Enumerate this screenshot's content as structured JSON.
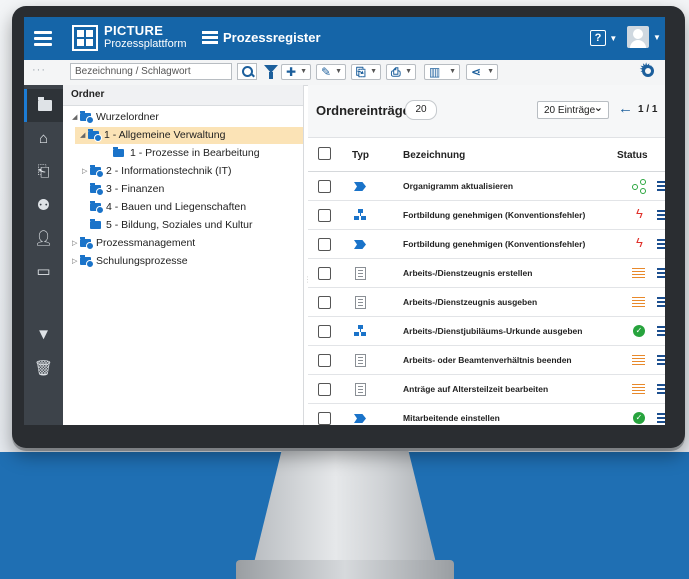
{
  "app": {
    "brand_line1": "PICTURE",
    "brand_line2": "Prozessplattform",
    "module_title": "Prozessregister",
    "help_label": "?"
  },
  "toolbar": {
    "search_placeholder": "Bezeichnung / Schlagwort"
  },
  "folder_panel": {
    "header": "Ordner",
    "tree": [
      {
        "label": "Wurzelordner",
        "level": 0,
        "expanded": true,
        "selected": false
      },
      {
        "label": "1 - Allgemeine Verwaltung",
        "level": 1,
        "expanded": true,
        "selected": true
      },
      {
        "label": "1 - Prozesse in Bearbeitung",
        "level": 2,
        "expanded": false,
        "selected": false
      },
      {
        "label": "2 - Informationstechnik (IT)",
        "level": 1,
        "expanded": false,
        "selected": false
      },
      {
        "label": "3 - Finanzen",
        "level": 1,
        "expanded": false,
        "selected": false
      },
      {
        "label": "4 - Bauen und Liegenschaften",
        "level": 1,
        "expanded": false,
        "selected": false
      },
      {
        "label": "5 - Bildung, Soziales und Kultur",
        "level": 1,
        "expanded": false,
        "selected": false
      },
      {
        "label": "Prozessmanagement",
        "level": 0,
        "expanded": false,
        "selected": false
      },
      {
        "label": "Schulungsprozesse",
        "level": 0,
        "expanded": false,
        "selected": false
      }
    ]
  },
  "main": {
    "title": "Ordnereinträge",
    "count": "20",
    "page_size": "20 Einträge",
    "pager": "1 / 1",
    "columns": {
      "type": "Typ",
      "name": "Bezeichnung",
      "status": "Status"
    },
    "rows": [
      {
        "type": "process-arrow",
        "name": "Organigramm aktualisieren",
        "status": "share"
      },
      {
        "type": "org-chart",
        "name": "Fortbildung genehmigen (Konventionsfehler)",
        "status": "error"
      },
      {
        "type": "process-arrow",
        "name": "Fortbildung genehmigen (Konventionsfehler)",
        "status": "error"
      },
      {
        "type": "document",
        "name": "Arbeits-/Dienstzeugnis erstellen",
        "status": "in-progress"
      },
      {
        "type": "document",
        "name": "Arbeits-/Dienstzeugnis ausgeben",
        "status": "in-progress"
      },
      {
        "type": "org-chart",
        "name": "Arbeits-/Dienstjubiläums-Urkunde ausgeben",
        "status": "ok"
      },
      {
        "type": "document",
        "name": "Arbeits- oder Beamtenverhältnis beenden",
        "status": "in-progress"
      },
      {
        "type": "document",
        "name": "Anträge auf Altersteilzeit bearbeiten",
        "status": "in-progress"
      },
      {
        "type": "process-arrow",
        "name": "Mitarbeitende einstellen",
        "status": "ok"
      }
    ]
  },
  "colors": {
    "topbar": "#1565a8",
    "rail": "#3d434a",
    "selected_folder": "#fbe3b6",
    "accent": "#1a73c9",
    "ok": "#27a33d",
    "error": "#e0302a",
    "in_progress": "#e8892b"
  }
}
